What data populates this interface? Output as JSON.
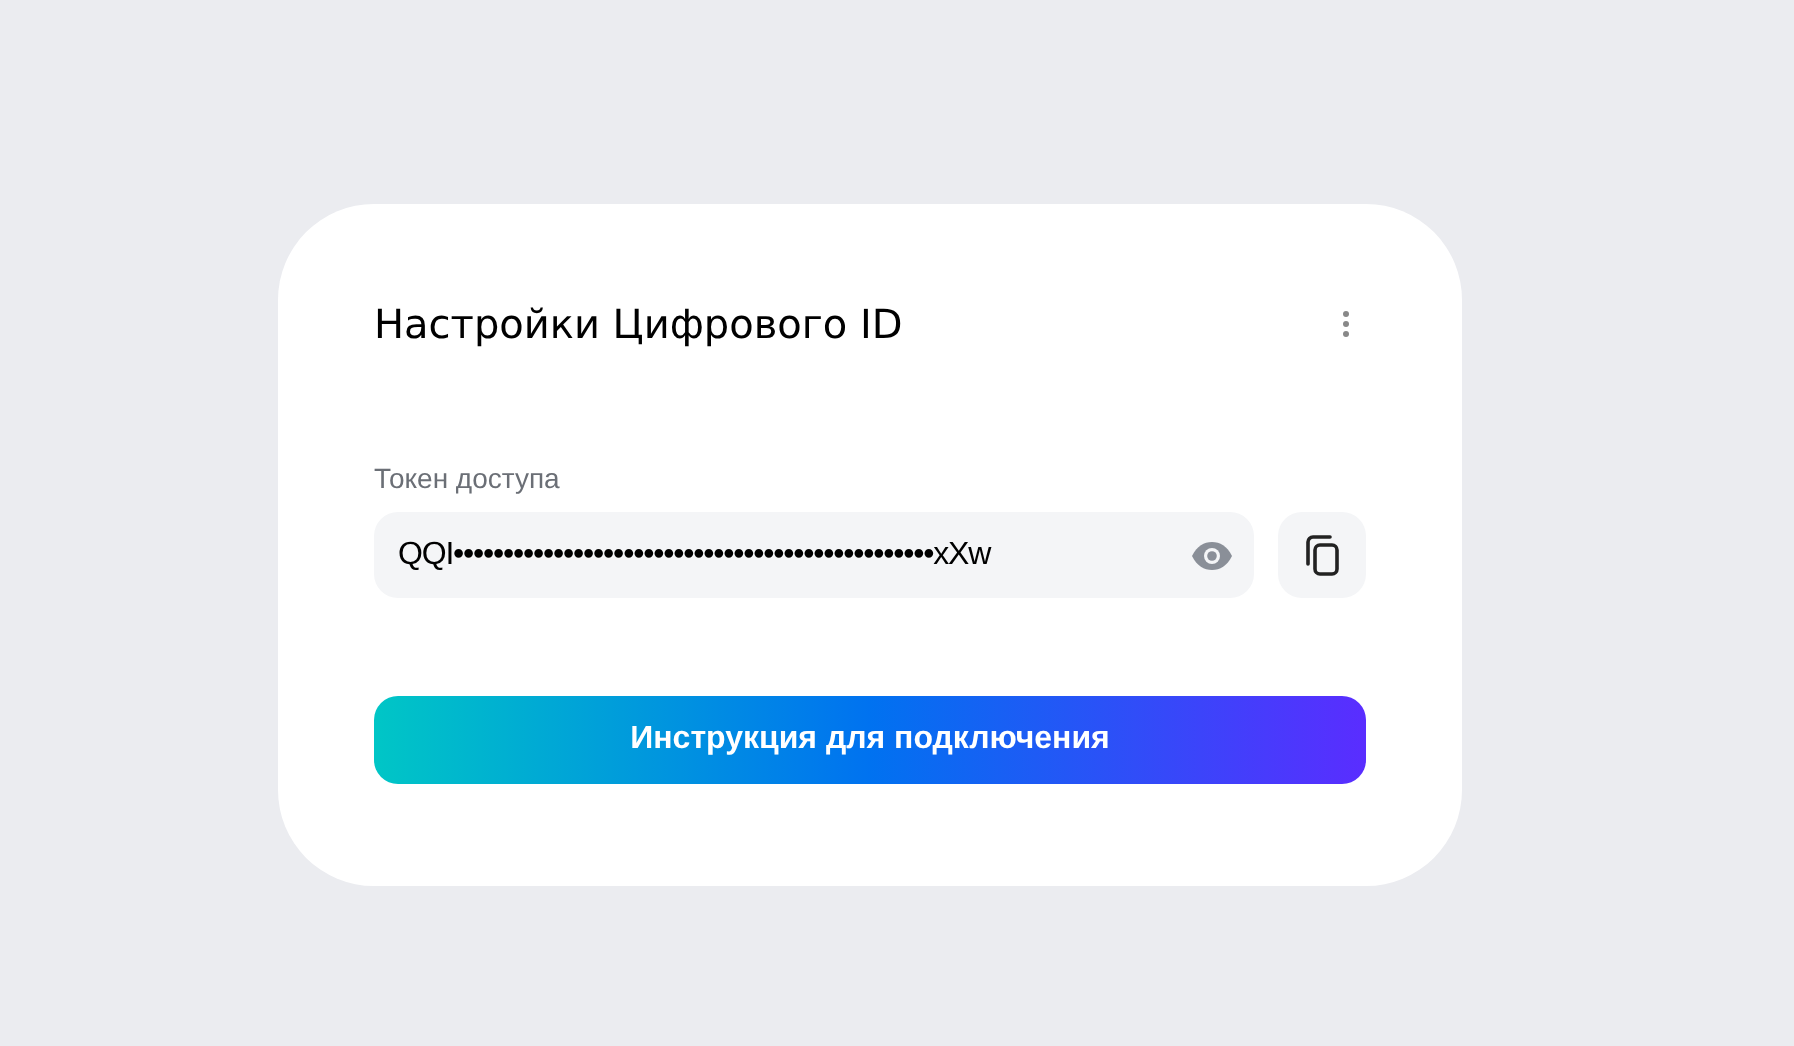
{
  "card": {
    "title": "Настройки Цифрового ID"
  },
  "token": {
    "label": "Токен доступа",
    "value": "QQI••••••••••••••••••••••••••••••••••••••••••••••••xXw",
    "masked": true
  },
  "button": {
    "label": "Инструкция для подключения"
  }
}
